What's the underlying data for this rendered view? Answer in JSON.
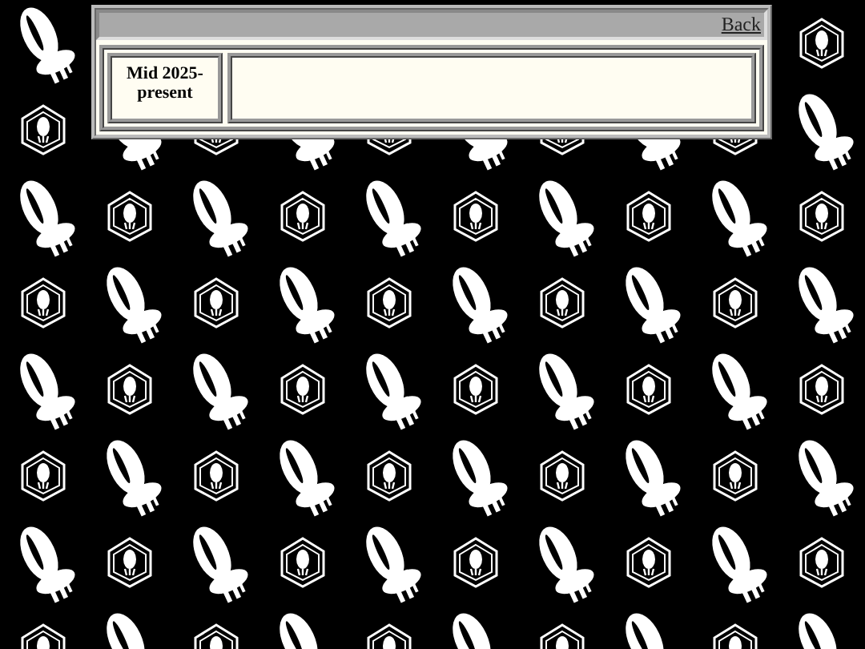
{
  "header": {
    "link": "Back"
  },
  "entries": [
    {
      "date": "Mid 2025-present"
    }
  ]
}
